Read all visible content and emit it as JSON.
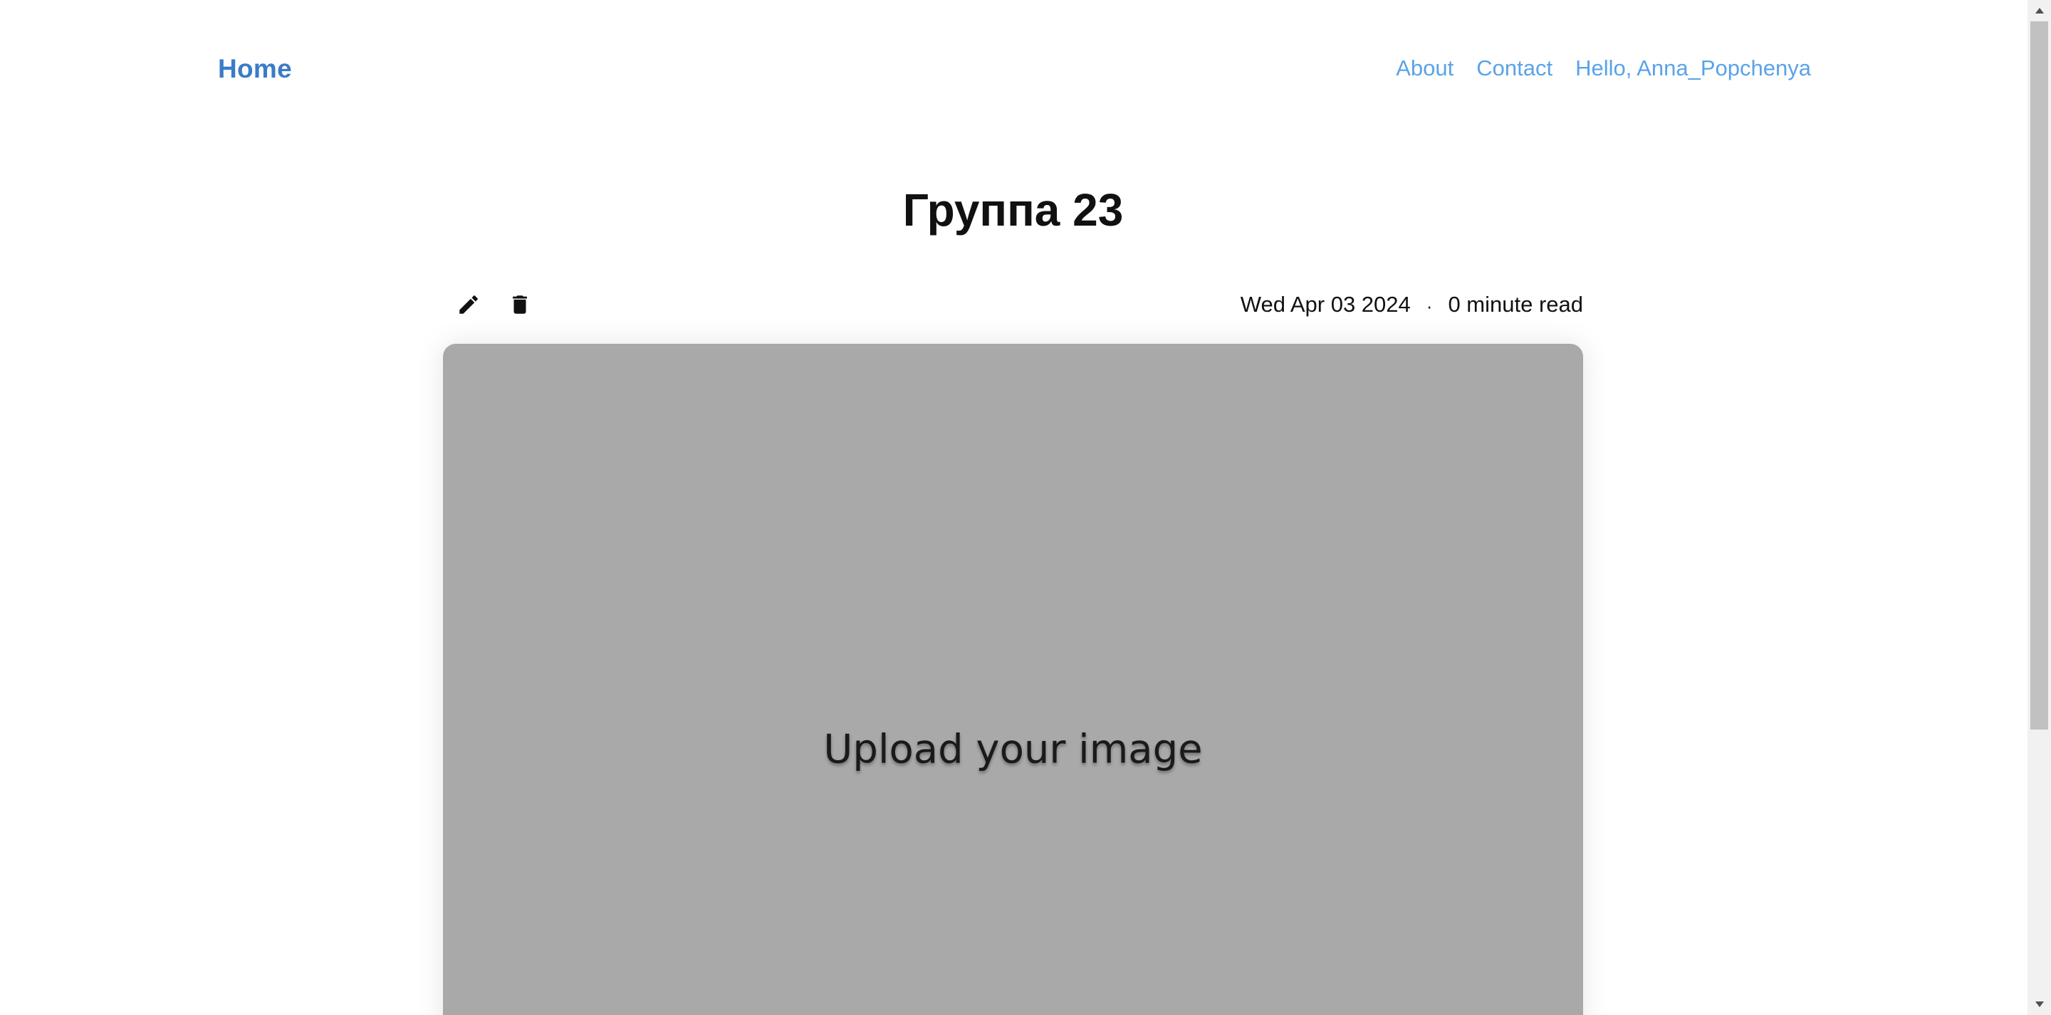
{
  "header": {
    "home_label": "Home",
    "nav": {
      "about": "About",
      "contact": "Contact",
      "user_greeting": "Hello, Anna_Popchenya"
    }
  },
  "post": {
    "title": "Группа 23",
    "date": "Wed Apr 03 2024",
    "separator": "·",
    "read_time": "0 minute read",
    "image_placeholder": "Upload your image"
  },
  "icons": {
    "edit": "pencil-icon",
    "delete": "trash-icon",
    "scroll_up": "triangle-up",
    "scroll_down": "triangle-down"
  },
  "colors": {
    "home_link": "#3a7cc7",
    "nav_link": "#5aa3e8",
    "image_placeholder_bg": "#a9a9a9"
  }
}
